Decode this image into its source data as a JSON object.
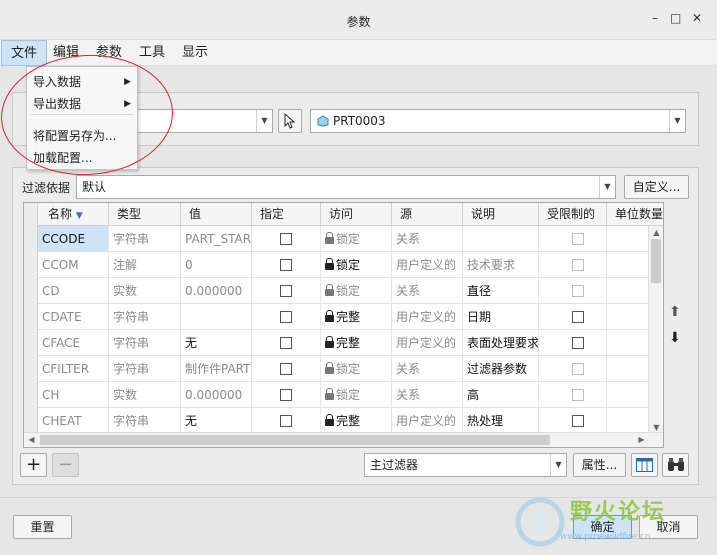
{
  "window": {
    "title": "参数",
    "minimize": "–",
    "maximize": "□",
    "close": "✕"
  },
  "menu": [
    "文件",
    "编辑",
    "参数",
    "工具",
    "显示"
  ],
  "file_menu": {
    "import": "导入数据",
    "export": "导出数据",
    "save_config": "将配置另存为...",
    "load_config": "加载配置..."
  },
  "lookin": {
    "object_value": "PRT0003"
  },
  "filter": {
    "label": "过滤依据",
    "value": "默认",
    "customize": "自定义..."
  },
  "table": {
    "columns": [
      "名称",
      "类型",
      "值",
      "指定",
      "访问",
      "源",
      "说明",
      "受限制的",
      "单位数量"
    ],
    "rows": [
      {
        "name": "CCODE",
        "type": "字符串",
        "value": "PART_STAR",
        "access": "锁定",
        "source": "关系",
        "desc": ""
      },
      {
        "name": "CCOM",
        "type": "注解",
        "value": "0",
        "access": "锁定",
        "source": "用户定义的",
        "desc": "技术要求"
      },
      {
        "name": "CD",
        "type": "实数",
        "value": "0.000000",
        "access": "锁定",
        "source": "关系",
        "desc": "直径"
      },
      {
        "name": "CDATE",
        "type": "字符串",
        "value": "",
        "access": "完整",
        "source": "用户定义的",
        "desc": "日期"
      },
      {
        "name": "CFACE",
        "type": "字符串",
        "value": "无",
        "access": "完整",
        "source": "用户定义的",
        "desc": "表面处理要求"
      },
      {
        "name": "CFILTER",
        "type": "字符串",
        "value": "制作件PART",
        "access": "锁定",
        "source": "关系",
        "desc": "过滤器参数"
      },
      {
        "name": "CH",
        "type": "实数",
        "value": "0.000000",
        "access": "锁定",
        "source": "关系",
        "desc": "高"
      },
      {
        "name": "CHEAT",
        "type": "字符串",
        "value": "无",
        "access": "完整",
        "source": "用户定义的",
        "desc": "热处理"
      }
    ]
  },
  "bottom": {
    "add": "+",
    "remove": "−",
    "filter_value": "主过滤器",
    "properties": "属性..."
  },
  "footer": {
    "reset": "重置",
    "ok": "确定",
    "cancel": "取消"
  },
  "watermark": {
    "text": "野火论坛",
    "url": "www.proewildfire.cn"
  },
  "colors": {
    "selected_cell": "#cfe3f6",
    "annotation": "#dd2222"
  }
}
